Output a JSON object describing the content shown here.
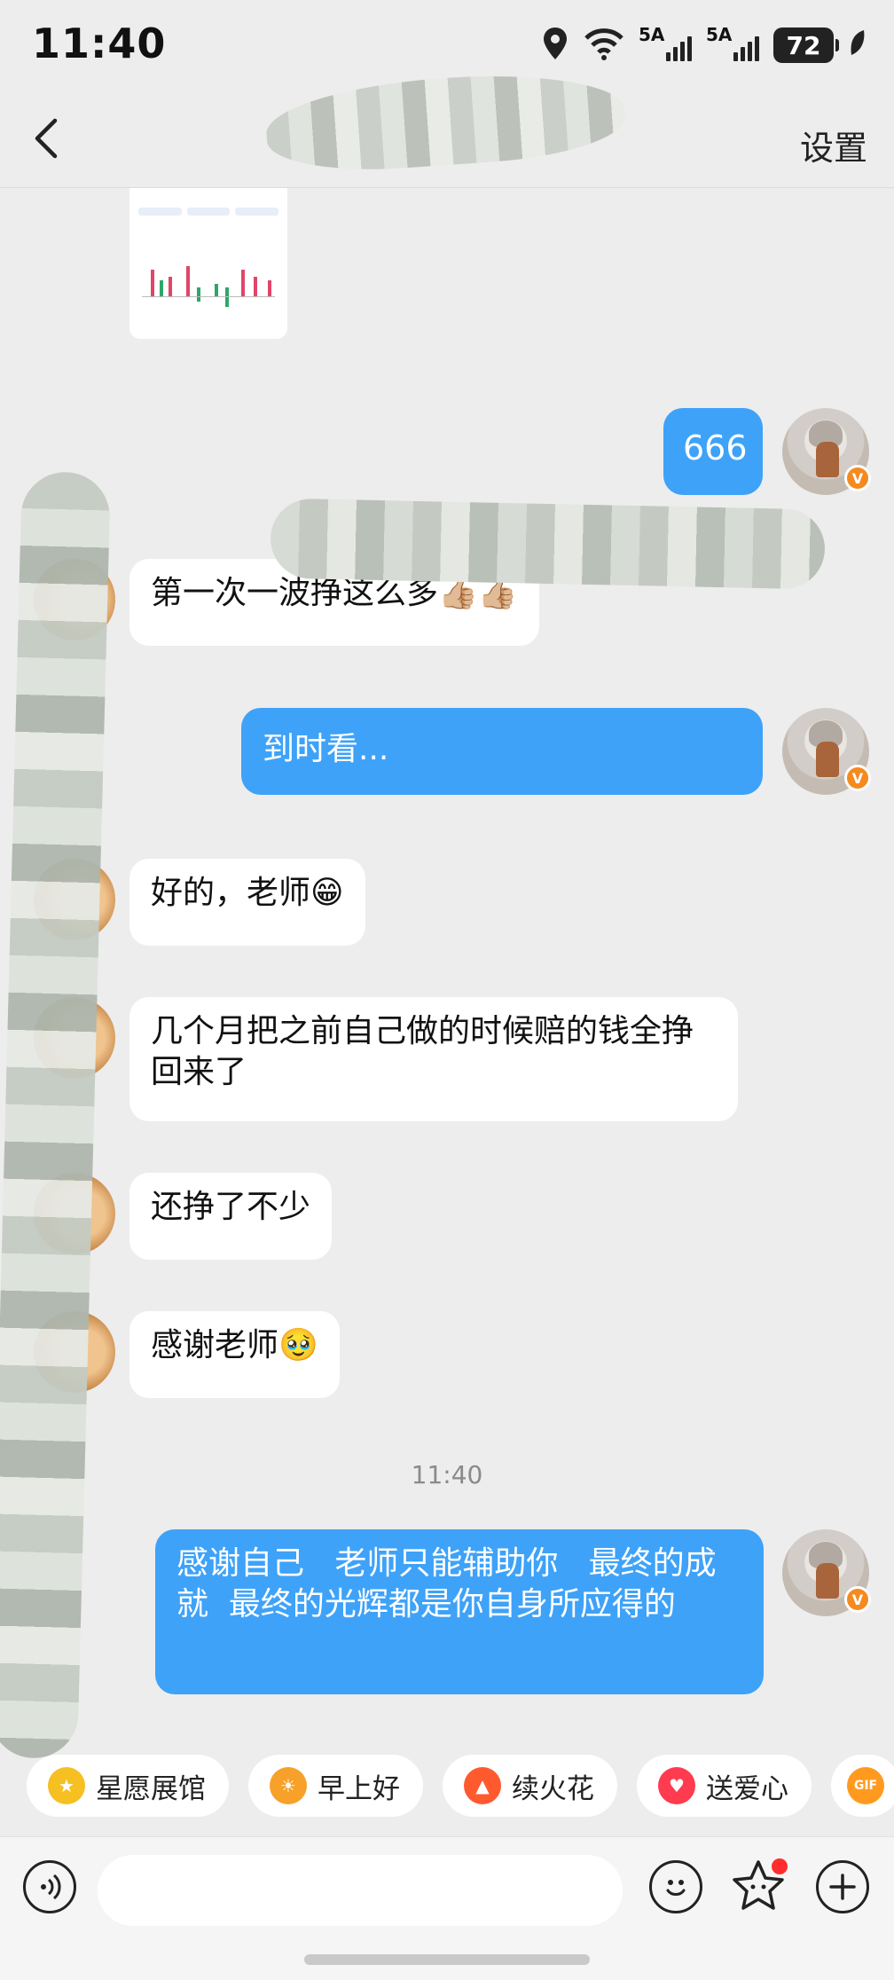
{
  "status_bar": {
    "time": "11:40",
    "signal1": "5A",
    "signal2": "5A",
    "battery": "72",
    "icons": [
      "location-icon",
      "wifi-icon",
      "signal-icon",
      "battery-icon",
      "leaf-icon"
    ]
  },
  "header": {
    "back_icon": "chevron-left-icon",
    "settings_label": "设置"
  },
  "messages": [
    {
      "side": "out",
      "text": "666"
    },
    {
      "side": "in",
      "text": "第一次一波挣这么多👍🏼👍🏼"
    },
    {
      "side": "out",
      "text": "到时看..."
    },
    {
      "side": "in",
      "text": "好的，老师😁"
    },
    {
      "side": "in",
      "text": "几个月把之前自己做的时候赔的钱全挣回来了"
    },
    {
      "side": "in",
      "text": "还挣了不少"
    },
    {
      "side": "in",
      "text": "感谢老师🥹"
    },
    {
      "side": "out",
      "text": "感谢自己   老师只能辅助你   最终的成就  最终的光辉都是你自身所应得的"
    }
  ],
  "timestamp": "11:40",
  "chips": [
    {
      "label": "星愿展馆",
      "icon": "star-icon",
      "color": "#f6c022"
    },
    {
      "label": "早上好",
      "icon": "sun-face-icon",
      "color": "#f7a12a"
    },
    {
      "label": "续火花",
      "icon": "fire-icon",
      "color": "#ff5a2e"
    },
    {
      "label": "送爱心",
      "icon": "heart-icon",
      "color": "#ff3b4f"
    },
    {
      "label": "GIF",
      "icon": "gif-icon",
      "color": "#ff9a1f"
    }
  ],
  "bottom_bar": {
    "voice_icon": "voice-icon",
    "emoji_icon": "smiley-icon",
    "star_icon": "star-face-icon",
    "plus_icon": "plus-circle-icon"
  }
}
